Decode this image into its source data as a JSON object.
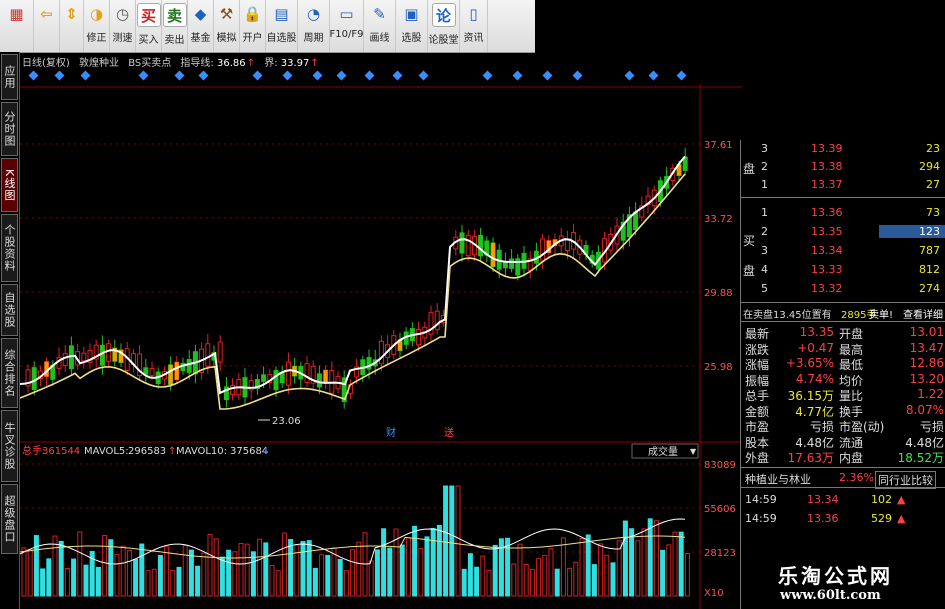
{
  "toolbar": {
    "buttons": [
      {
        "label": "",
        "icon": "grid-icon"
      },
      {
        "label": "",
        "icon": "back-arrow-icon"
      },
      {
        "label": "",
        "icon": "up-down-arrows-icon"
      },
      {
        "label": "修正",
        "icon": "fix-icon"
      },
      {
        "label": "测速",
        "icon": "speed-clock-icon"
      },
      {
        "label": "买入",
        "icon": "buy-icon",
        "icon_text": "买"
      },
      {
        "label": "卖出",
        "icon": "sell-icon",
        "icon_text": "卖"
      },
      {
        "label": "基金",
        "icon": "fund-icon"
      },
      {
        "label": "模拟",
        "icon": "hammer-icon"
      },
      {
        "label": "开户",
        "icon": "lock-icon"
      },
      {
        "label": "自选股",
        "icon": "favorites-icon"
      },
      {
        "label": "周期",
        "icon": "period-clock-icon"
      },
      {
        "label": "F10/F9",
        "icon": "f10-icon"
      },
      {
        "label": "画线",
        "icon": "pen-icon"
      },
      {
        "label": "选股",
        "icon": "stock-picker-icon"
      },
      {
        "label": "论股堂",
        "icon": "forum-icon",
        "icon_text": "论"
      },
      {
        "label": "资讯",
        "icon": "news-icon"
      }
    ]
  },
  "left_tabs": [
    "应用",
    "分时图",
    "K线图",
    "个股资料",
    "自选股",
    "综合排名",
    "牛叉诊股",
    "超级盘口"
  ],
  "info": {
    "period": "日线(复权)",
    "name": "敦煌种业",
    "indicator": "BS买卖点",
    "guide_label": "指导线:",
    "guide_value": "36.86",
    "bound_label": "界:",
    "bound_value": "33.97"
  },
  "price_axis": [
    "37.61",
    "33.72",
    "29.88",
    "25.98"
  ],
  "low_label": "23.06",
  "events": [
    "财",
    "送"
  ],
  "volume": {
    "total_label": "总手:",
    "total_value": "361544",
    "vol5_label": "MAVOL5:",
    "vol5_value": "296583",
    "vol10_label": "MAVOL10:",
    "vol10_value": "375684",
    "selector": "成交量",
    "axis": [
      "83089",
      "55606",
      "28123",
      "X10"
    ]
  },
  "asks": [
    {
      "level": "3",
      "price": "13.39",
      "vol": "23"
    },
    {
      "level": "2",
      "price": "13.38",
      "vol": "294"
    },
    {
      "level": "1",
      "price": "13.37",
      "vol": "27"
    }
  ],
  "bids": [
    {
      "level": "1",
      "price": "13.36",
      "vol": "73"
    },
    {
      "level": "2",
      "price": "13.35",
      "vol": "123"
    },
    {
      "level": "3",
      "price": "13.34",
      "vol": "787"
    },
    {
      "level": "4",
      "price": "13.33",
      "vol": "812"
    },
    {
      "level": "5",
      "price": "13.32",
      "vol": "274"
    }
  ],
  "ask_label": "盘",
  "bid_label": [
    "买",
    "盘"
  ],
  "order_line": {
    "text": "在卖盘13.45位置有",
    "qty": "2895手",
    "action": "卖单!",
    "detail": "查看详细"
  },
  "quote": [
    {
      "l1": "最新",
      "v1": "13.35",
      "l2": "开盘",
      "v2": "13.01"
    },
    {
      "l1": "涨跌",
      "v1": "+0.47",
      "l2": "最高",
      "v2": "13.47"
    },
    {
      "l1": "涨幅",
      "v1": "+3.65%",
      "l2": "最低",
      "v2": "12.86"
    },
    {
      "l1": "振幅",
      "v1": "4.74%",
      "l2": "均价",
      "v2": "13.20"
    },
    {
      "l1": "总手",
      "v1": "36.15万",
      "l2": "量比",
      "v2": "1.22"
    },
    {
      "l1": "金额",
      "v1": "4.77亿",
      "l2": "换手",
      "v2": "8.07%"
    },
    {
      "l1": "市盈",
      "v1": "亏损",
      "l2": "市盈(动)",
      "v2": "亏损"
    },
    {
      "l1": "股本",
      "v1": "4.48亿",
      "l2": "流通",
      "v2": "4.48亿"
    },
    {
      "l1": "外盘",
      "v1": "17.63万",
      "l2": "内盘",
      "v2": "18.52万"
    }
  ],
  "industry": {
    "name": "种植业与林业",
    "pct": "2.36%",
    "compare": "同行业比较"
  },
  "ticks": [
    {
      "time": "14:59",
      "price": "13.34",
      "vol": "102"
    },
    {
      "time": "14:59",
      "price": "13.36",
      "vol": "529"
    }
  ],
  "watermark": {
    "title": "乐淘公式网",
    "url": "www.60lt.com"
  }
}
